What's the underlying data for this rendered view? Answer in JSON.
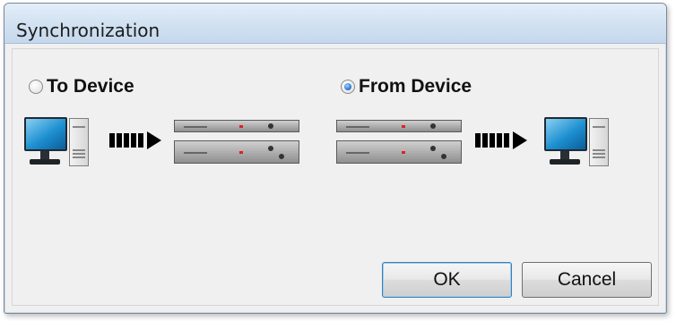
{
  "window": {
    "title": "Synchronization"
  },
  "options": {
    "to_device": {
      "label": "To Device",
      "checked": false
    },
    "from_device": {
      "label": "From Device",
      "checked": true
    }
  },
  "buttons": {
    "ok": "OK",
    "cancel": "Cancel"
  },
  "colors": {
    "titlebar": "#d2e2f2",
    "accent": "#1f6bd0",
    "dialog_bg": "#f0f0f0"
  },
  "icons": [
    "computer-icon",
    "transfer-arrow-icon",
    "device-rack-icon"
  ]
}
